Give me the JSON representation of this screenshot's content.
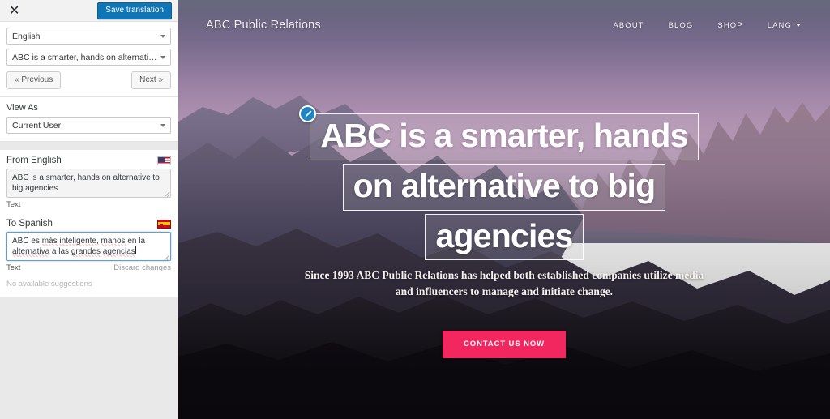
{
  "sidebar": {
    "close_label": "✕",
    "save_label": "Save translation",
    "language_select": "English",
    "string_select": "ABC is a smarter, hands on alternative t...",
    "prev_label": "« Previous",
    "next_label": "Next »",
    "view_as_label": "View As",
    "view_as_value": "Current User",
    "source": {
      "label": "From English",
      "flag": "us-flag-icon",
      "value": "ABC is a smarter, hands on alternative to big agencies",
      "type_label": "Text"
    },
    "target": {
      "label": "To Spanish",
      "flag": "es-flag-icon",
      "value": "ABC es más inteligente, manos en la alternativa a las grandes agencias",
      "words": [
        "ABC",
        "es",
        "más",
        "inteligente,",
        "manos",
        "en",
        "la",
        "alternativa",
        "a",
        "las",
        "grandes",
        "agencias"
      ],
      "misspelled": [
        "más",
        "inteligente,",
        "manos",
        "alternativa",
        "grandes",
        "agencias"
      ],
      "type_label": "Text",
      "discard_label": "Discard changes",
      "suggestions_label": "No available suggestions"
    }
  },
  "site": {
    "brand": "ABC Public Relations",
    "nav": [
      {
        "label": "ABOUT"
      },
      {
        "label": "BLOG"
      },
      {
        "label": "SHOP"
      },
      {
        "label": "LANG",
        "has_caret": true
      }
    ],
    "headline_lines": [
      "ABC is a smarter, hands",
      "on alternative to big",
      "agencies"
    ],
    "edit_icon": "pencil-icon",
    "subtitle_lines": [
      "Since 1993 ABC Public Relations has helped both established companies utilize media",
      "and influencers to manage and initiate change."
    ],
    "cta_label": "CONTACT US NOW"
  },
  "colors": {
    "save_button": "#0e76b7",
    "cta_button": "#f2275f",
    "edit_pencil": "#1e86c4",
    "sidebar_bg": "#e9e9e9"
  }
}
